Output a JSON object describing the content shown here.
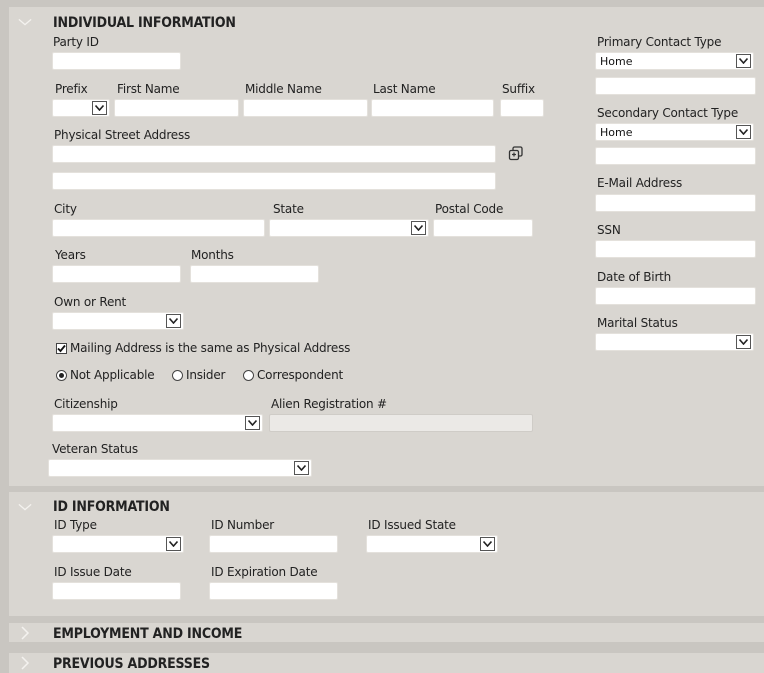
{
  "individual": {
    "title": "INDIVIDUAL INFORMATION",
    "party_id_label": "Party ID",
    "prefix_label": "Prefix",
    "first_name_label": "First Name",
    "middle_name_label": "Middle Name",
    "last_name_label": "Last Name",
    "suffix_label": "Suffix",
    "street_label": "Physical Street Address",
    "city_label": "City",
    "state_label": "State",
    "postal_label": "Postal Code",
    "years_label": "Years",
    "months_label": "Months",
    "own_rent_label": "Own or Rent",
    "mailing_same_label": "Mailing Address is the same as Physical Address",
    "mailing_same_checked": true,
    "radio_options": [
      "Not Applicable",
      "Insider",
      "Correspondent"
    ],
    "radio_selected": "Not Applicable",
    "citizenship_label": "Citizenship",
    "alien_label": "Alien Registration #",
    "veteran_label": "Veteran Status",
    "primary_contact_label": "Primary Contact Type",
    "primary_contact_value": "Home",
    "secondary_contact_label": "Secondary Contact Type",
    "secondary_contact_value": "Home",
    "email_label": "E-Mail Address",
    "ssn_label": "SSN",
    "dob_label": "Date of Birth",
    "marital_label": "Marital Status"
  },
  "id_info": {
    "title": "ID INFORMATION",
    "id_type_label": "ID Type",
    "id_number_label": "ID Number",
    "id_state_label": "ID Issued State",
    "issue_date_label": "ID Issue Date",
    "exp_date_label": "ID Expiration Date"
  },
  "employment": {
    "title": "EMPLOYMENT AND INCOME"
  },
  "previous": {
    "title": "PREVIOUS ADDRESSES"
  },
  "colors": {
    "panel": "#d9d6d1",
    "background": "#c9c6c1",
    "chevron": "#f4f2ef"
  },
  "icons": {
    "chevron_down": "chevron-down-icon",
    "chevron_right": "chevron-right-icon",
    "copy": "copy-icon",
    "dropdown_arrow": "dropdown-arrow-icon"
  }
}
